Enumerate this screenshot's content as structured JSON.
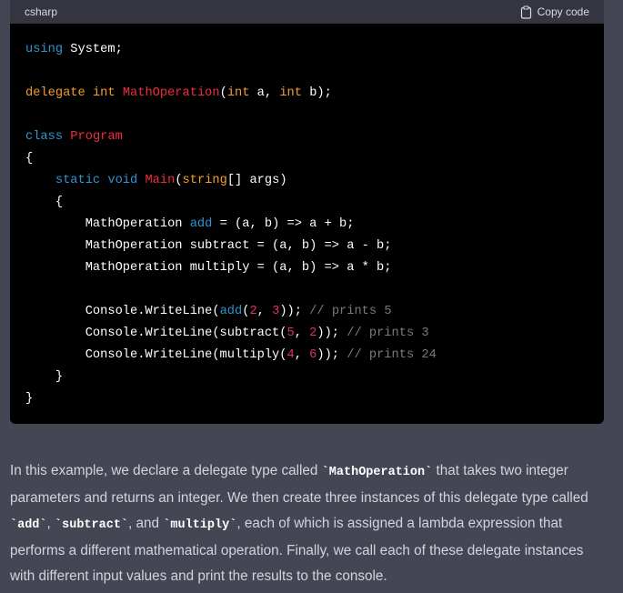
{
  "code_block": {
    "language": "csharp",
    "copy_label": "Copy code",
    "lines": [
      [
        [
          "kw",
          "using"
        ],
        [
          "id",
          " System;"
        ]
      ],
      [],
      [
        [
          "kw2",
          "delegate"
        ],
        [
          "id",
          " "
        ],
        [
          "kw2",
          "int"
        ],
        [
          "id",
          " "
        ],
        [
          "ty",
          "MathOperation"
        ],
        [
          "id",
          "("
        ],
        [
          "kw2",
          "int"
        ],
        [
          "id",
          " a, "
        ],
        [
          "kw2",
          "int"
        ],
        [
          "id",
          " b);"
        ]
      ],
      [],
      [
        [
          "kw",
          "class"
        ],
        [
          "id",
          " "
        ],
        [
          "ty",
          "Program"
        ]
      ],
      [
        [
          "id",
          "{"
        ]
      ],
      [
        [
          "id",
          "    "
        ],
        [
          "kw",
          "static"
        ],
        [
          "id",
          " "
        ],
        [
          "kw",
          "void"
        ],
        [
          "id",
          " "
        ],
        [
          "ty",
          "Main"
        ],
        [
          "id",
          "("
        ],
        [
          "kw2",
          "string"
        ],
        [
          "id",
          "[] args)"
        ]
      ],
      [
        [
          "id",
          "    {"
        ]
      ],
      [
        [
          "id",
          "        MathOperation "
        ],
        [
          "kw",
          "add"
        ],
        [
          "id",
          " = (a, b) => a + b;"
        ]
      ],
      [
        [
          "id",
          "        MathOperation subtract = (a, b) => a - b;"
        ]
      ],
      [
        [
          "id",
          "        MathOperation multiply = (a, b) => a * b;"
        ]
      ],
      [],
      [
        [
          "id",
          "        Console.WriteLine("
        ],
        [
          "kw",
          "add"
        ],
        [
          "id",
          "("
        ],
        [
          "num",
          "2"
        ],
        [
          "id",
          ", "
        ],
        [
          "num",
          "3"
        ],
        [
          "id",
          "));"
        ],
        [
          "cm",
          " // prints 5"
        ]
      ],
      [
        [
          "id",
          "        Console.WriteLine(subtract("
        ],
        [
          "num",
          "5"
        ],
        [
          "id",
          ", "
        ],
        [
          "num",
          "2"
        ],
        [
          "id",
          "));"
        ],
        [
          "cm",
          " // prints 3"
        ]
      ],
      [
        [
          "id",
          "        Console.WriteLine(multiply("
        ],
        [
          "num",
          "4"
        ],
        [
          "id",
          ", "
        ],
        [
          "num",
          "6"
        ],
        [
          "id",
          "));"
        ],
        [
          "cm",
          " // prints 24"
        ]
      ],
      [
        [
          "id",
          "    }"
        ]
      ],
      [
        [
          "id",
          "}"
        ]
      ]
    ]
  },
  "explanation": {
    "parts": [
      [
        "t",
        "In this example, we declare a delegate type called "
      ],
      [
        "c",
        "`MathOperation`"
      ],
      [
        "t",
        " that takes two integer parameters and returns an integer. We then create three instances of this delegate type called "
      ],
      [
        "c",
        "`add`"
      ],
      [
        "t",
        ", "
      ],
      [
        "c",
        "`subtract`"
      ],
      [
        "t",
        ", and "
      ],
      [
        "c",
        "`multiply`"
      ],
      [
        "t",
        ", each of which is assigned a lambda expression that performs a different mathematical operation. Finally, we call each of these delegate instances with different input values and print the results to the console."
      ]
    ]
  }
}
